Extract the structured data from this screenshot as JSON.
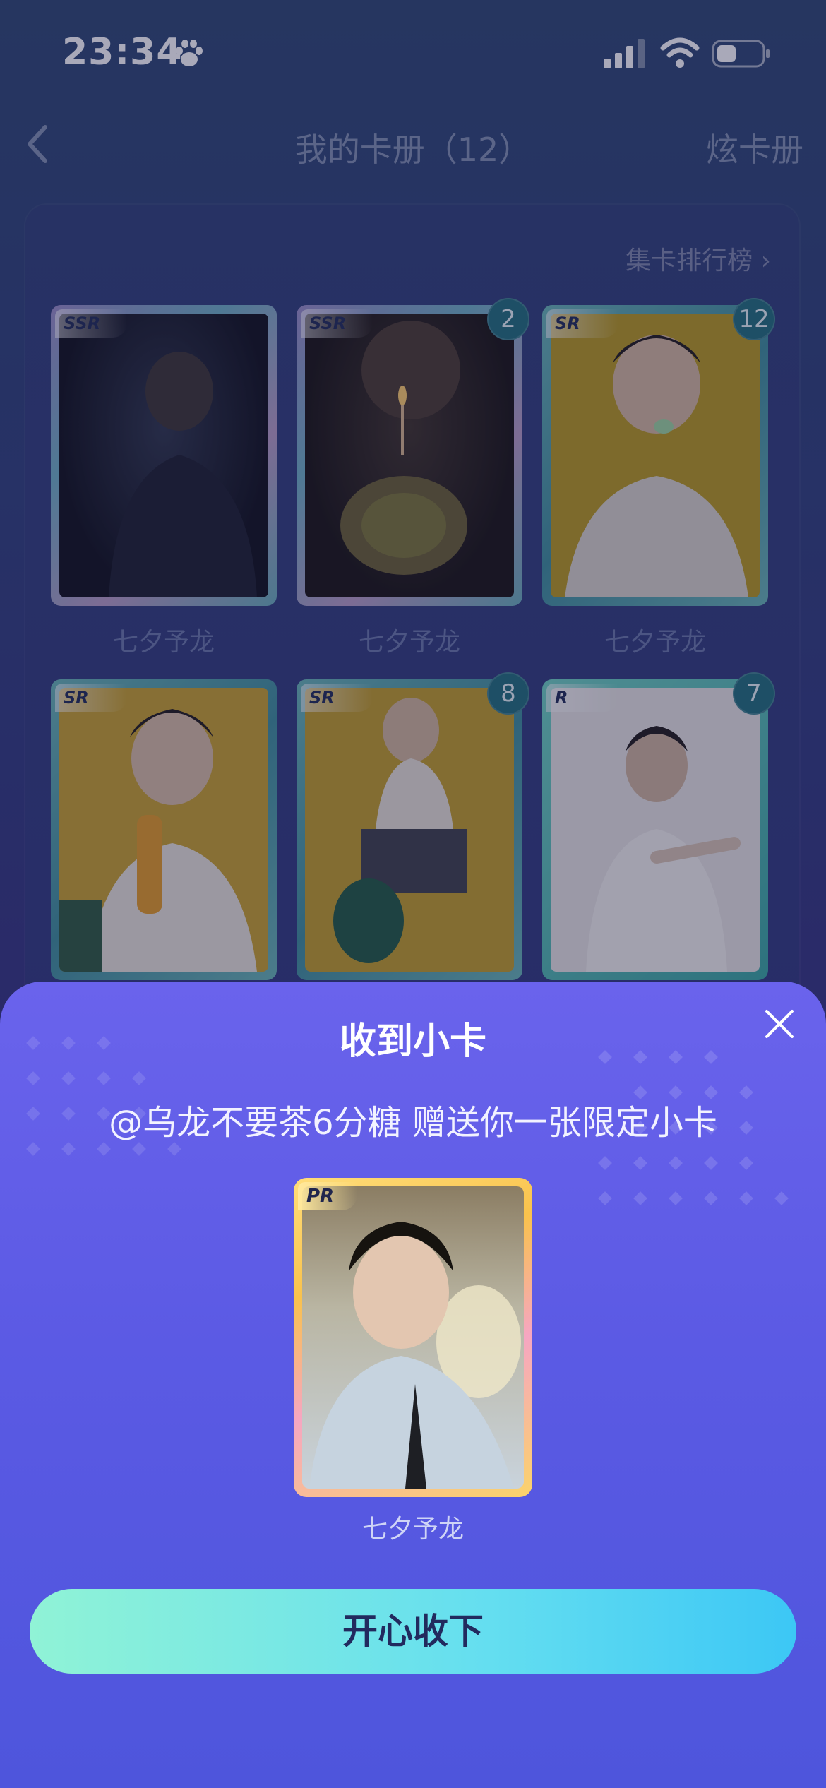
{
  "status": {
    "time": "23:34"
  },
  "nav": {
    "title": "我的卡册（12）",
    "right_label": "炫卡册"
  },
  "album": {
    "rank_link": "集卡排行榜",
    "cards": [
      {
        "rarity": "SSR",
        "count": "",
        "name": "七夕予龙"
      },
      {
        "rarity": "SSR",
        "count": "2",
        "name": "七夕予龙"
      },
      {
        "rarity": "SR",
        "count": "12",
        "name": "七夕予龙"
      },
      {
        "rarity": "SR",
        "count": "",
        "name": ""
      },
      {
        "rarity": "SR",
        "count": "8",
        "name": ""
      },
      {
        "rarity": "R",
        "count": "7",
        "name": ""
      }
    ]
  },
  "sheet": {
    "title": "收到小卡",
    "message": "@乌龙不要茶6分糖 赠送你一张限定小卡",
    "card": {
      "rarity": "PR",
      "name": "七夕予龙"
    },
    "accept_label": "开心收下"
  },
  "colors": {
    "accent_gradient_start": "#90f3d6",
    "accent_gradient_end": "#3cc7f5",
    "sheet": "#5b5ae4"
  }
}
